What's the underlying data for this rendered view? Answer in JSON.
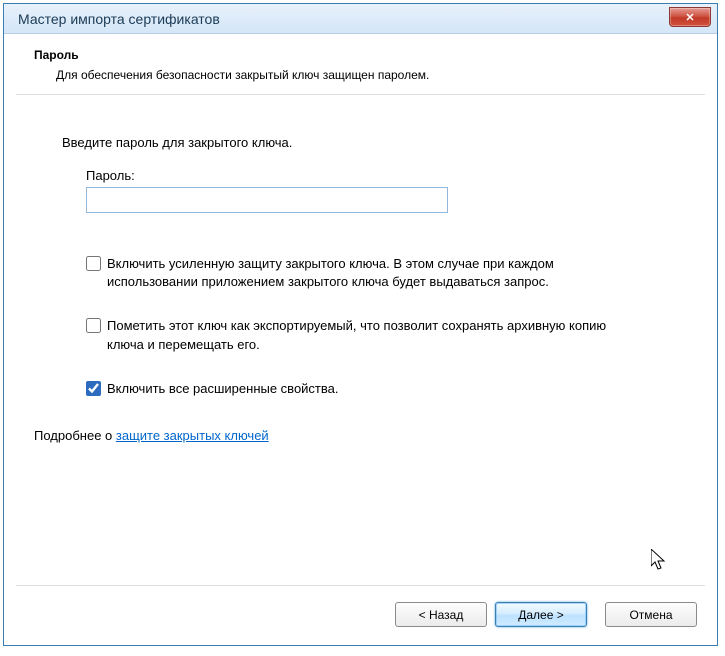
{
  "window": {
    "title": "Мастер импорта сертификатов",
    "close_symbol": "✕"
  },
  "page": {
    "heading": "Пароль",
    "subheading": "Для обеспечения безопасности закрытый ключ защищен паролем.",
    "instruction": "Введите пароль для закрытого ключа.",
    "password_label": "Пароль:",
    "password_value": ""
  },
  "options": {
    "strong_protection": {
      "checked": false,
      "label": "Включить усиленную защиту закрытого ключа. В этом случае при каждом использовании приложением закрытого ключа будет выдаваться запрос."
    },
    "exportable": {
      "checked": false,
      "label": "Пометить этот ключ как экспортируемый, что позволит сохранять архивную копию ключа и перемещать его."
    },
    "extended_props": {
      "checked": true,
      "label": "Включить все расширенные свойства."
    }
  },
  "more_info": {
    "prefix": "Подробнее о ",
    "link": "защите закрытых ключей"
  },
  "buttons": {
    "back": "< Назад",
    "next": "Далее >",
    "cancel": "Отмена"
  }
}
